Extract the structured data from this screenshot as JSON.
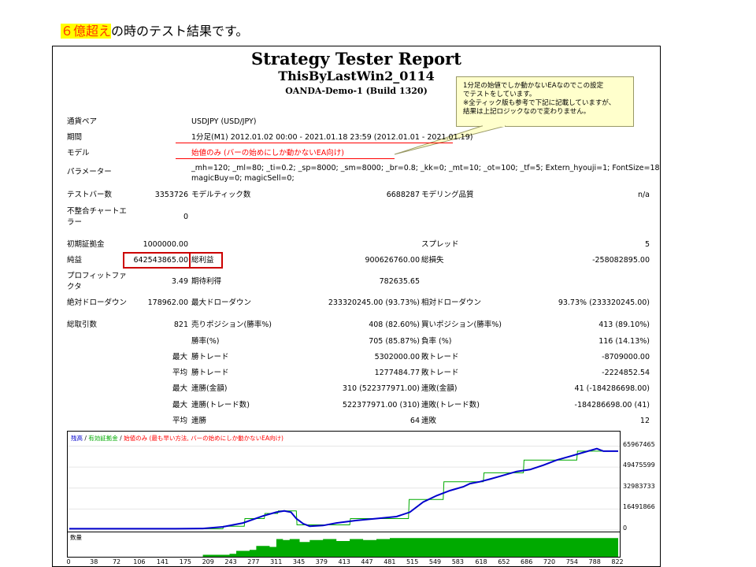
{
  "slide": {
    "highlight": "６億超え",
    "rest": "の時のテスト結果です。"
  },
  "report": {
    "title": "Strategy Tester Report",
    "ea_name": "ThisByLastWin2_0114",
    "server": "OANDA-Demo-1 (Build 1320)"
  },
  "callout": {
    "line1": "1分足の始値でしか動かないEAなのでこの設定",
    "line2": "でテストをしています。",
    "line3": "※全ティック版も参考で下記に記載していますが、",
    "line4": "結果は上記ロジックなので変わりません。"
  },
  "info": {
    "symbol_label": "通貨ペア",
    "symbol_value": "USDJPY (USD/JPY)",
    "period_label": "期間",
    "period_value": "1分足(M1) 2012.01.02 00:00 - 2021.01.18 23:59 (2012.01.01 - 2021.01.19)",
    "model_label": "モデル",
    "model_value": "始値のみ (バーの始めにしか動かないEA向け)",
    "params_label": "パラメーター",
    "params_line1": "_mh=120; _ml=80; _ti=0.2; _sp=8000; _sm=8000; _br=0.8; _kk=0; _mt=10; _ot=100; _tf=5; Extern_hyouji=1; FontSize=18;",
    "params_line2": "magicBuy=0; magicSell=0;"
  },
  "stats": {
    "bars_label": "テストバー数",
    "bars_value": "3353726",
    "ticks_label": "モデルティック数",
    "ticks_value": "6688287",
    "quality_label": "モデリング品質",
    "quality_value": "n/a",
    "mismatch_label_1": "不整合チャートエ",
    "mismatch_label_2": "ラー",
    "mismatch_value": "0",
    "deposit_label": "初期証拠金",
    "deposit_value": "1000000.00",
    "spread_label": "スプレッド",
    "spread_value": "5",
    "net_label": "純益",
    "net_value": "642543865.00",
    "gross_profit_label": "総利益",
    "gross_profit_value": "900626760.00",
    "gross_loss_label": "総損失",
    "gross_loss_value": "-258082895.00",
    "pf_label_1": "プロフィットファ",
    "pf_label_2": "クタ",
    "pf_value": "3.49",
    "payoff_label": "期待利得",
    "payoff_value": "782635.65",
    "abs_dd_label": "絶対ドローダウン",
    "abs_dd_value": "178962.00",
    "max_dd_label": "最大ドローダウン",
    "max_dd_value": "233320245.00 (93.73%)",
    "rel_dd_label": "相対ドローダウン",
    "rel_dd_value": "93.73% (233320245.00)",
    "trades_label": "総取引数",
    "trades_value": "821",
    "short_label": "売りポジション(勝率%)",
    "short_value": "408 (82.60%)",
    "long_label": "買いポジション(勝率%)",
    "long_value": "413 (89.10%)",
    "win_label": "勝率(%)",
    "win_value": "705 (85.87%)",
    "loss_label": "負率 (%)",
    "loss_value": "116 (14.13%)",
    "max_word": "最大",
    "avg_word": "平均",
    "largest_win_label": "勝トレード",
    "largest_win_value": "5302000.00",
    "largest_loss_label": "敗トレード",
    "largest_loss_value": "-8709000.00",
    "avg_win_label": "勝トレード",
    "avg_win_value": "1277484.77",
    "avg_loss_label": "敗トレード",
    "avg_loss_value": "-2224852.54",
    "cons_wins_money_label": "連勝(金額)",
    "cons_wins_money_value": "310 (522377971.00)",
    "cons_loss_money_label": "連敗(金額)",
    "cons_loss_money_value": "41 (-184286698.00)",
    "cons_wins_count_label": "連勝(トレード数)",
    "cons_wins_count_value": "522377971.00 (310)",
    "cons_loss_count_label": "連敗(トレード数)",
    "cons_loss_count_value": "-184286698.00 (41)",
    "avg_cons_wins_label": "連勝",
    "avg_cons_wins_value": "64",
    "avg_cons_loss_label": "連敗",
    "avg_cons_loss_value": "12"
  },
  "chart_legend": {
    "balance": "残高",
    "sep1": " / ",
    "equity": "有効証拠金",
    "sep2": " / ",
    "model": "始値のみ (最も早い方法, バーの始めにしか動かないEA向け)"
  },
  "volume_label": "数量",
  "colors": {
    "balance": "#0000cc",
    "equity": "#00aa00",
    "volume": "#00aa00",
    "highlight_bg": "#ffff00",
    "highlight_text": "#ff3300",
    "box": "#cc0000"
  },
  "chart_data": {
    "type": "line",
    "yticks": [
      "65967465",
      "49475599",
      "32983733",
      "16491866",
      "0"
    ],
    "ylim": [
      0,
      70000000
    ],
    "xticks": [
      "0",
      "38",
      "72",
      "106",
      "141",
      "175",
      "209",
      "243",
      "277",
      "311",
      "345",
      "379",
      "413",
      "447",
      "481",
      "515",
      "549",
      "583",
      "618",
      "652",
      "686",
      "720",
      "754",
      "788",
      "822"
    ],
    "xlim": [
      0,
      822
    ],
    "series": [
      {
        "name": "残高",
        "x": [
          0,
          100,
          160,
          200,
          230,
          260,
          290,
          310,
          322,
          332,
          340,
          350,
          360,
          380,
          400,
          430,
          460,
          490,
          510,
          530,
          550,
          570,
          590,
          600,
          615,
          630,
          650,
          670,
          690,
          710,
          730,
          750,
          770,
          790,
          800,
          822
        ],
        "y": [
          1000000,
          1000000,
          1000000,
          1200000,
          2500000,
          5500000,
          11000000,
          14000000,
          15000000,
          14000000,
          9000000,
          5000000,
          3000000,
          3500000,
          5500000,
          7500000,
          9000000,
          10500000,
          14000000,
          22000000,
          27000000,
          31000000,
          34000000,
          36500000,
          38000000,
          40000000,
          43000000,
          46000000,
          47500000,
          51000000,
          55000000,
          58000000,
          61000000,
          64000000,
          62000000,
          62000000
        ]
      },
      {
        "name": "有効証拠金",
        "x": [
          0,
          160,
          230,
          231,
          262,
          263,
          292,
          293,
          312,
          313,
          340,
          341,
          420,
          421,
          508,
          509,
          560,
          561,
          620,
          621,
          680,
          681,
          760,
          761,
          822
        ],
        "y": [
          1000000,
          1000000,
          1000000,
          3000000,
          3000000,
          9000000,
          9000000,
          13000000,
          13000000,
          15000000,
          15000000,
          4000000,
          4000000,
          9000000,
          9000000,
          24000000,
          24000000,
          38000000,
          38000000,
          45000000,
          45000000,
          55000000,
          55000000,
          62000000,
          62000000
        ]
      }
    ],
    "volume": {
      "name": "数量",
      "x": [
        0,
        170,
        200,
        240,
        250,
        270,
        280,
        300,
        310,
        320,
        330,
        345,
        360,
        380,
        400,
        420,
        440,
        460,
        480,
        822
      ],
      "y": [
        0,
        0,
        0.1,
        0.15,
        0.3,
        0.35,
        0.55,
        0.5,
        0.9,
        0.85,
        0.9,
        0.75,
        0.85,
        0.9,
        0.8,
        0.9,
        0.85,
        0.9,
        0.95,
        0.95
      ]
    }
  }
}
